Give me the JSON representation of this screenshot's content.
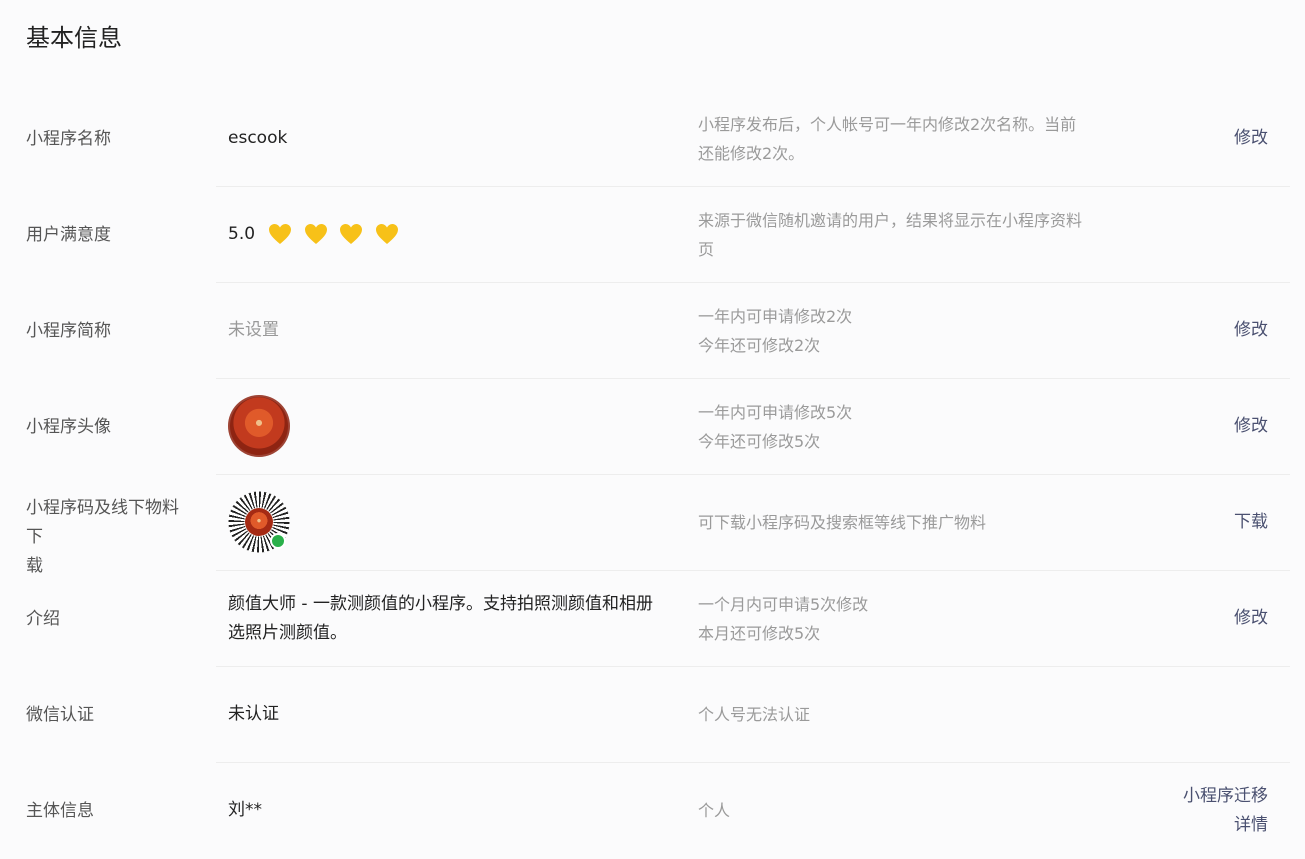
{
  "section_title": "基本信息",
  "colors": {
    "heart": "#f7c118",
    "action": "#4a5070",
    "muted": "#9a9a9a"
  },
  "rows": [
    {
      "label": "小程序名称",
      "value": "escook",
      "desc": [
        "小程序发布后，个人帐号可一年内修改2次名称。当前",
        "还能修改2次。"
      ],
      "action": [
        "修改"
      ]
    },
    {
      "label": "用户满意度",
      "value": "5.0",
      "hearts": 4,
      "desc": [
        "来源于微信随机邀请的用户，结果将显示在小程序资料",
        "页"
      ],
      "action": []
    },
    {
      "label": "小程序简称",
      "value": "未设置",
      "desc": [
        "一年内可申请修改2次",
        "今年还可修改2次"
      ],
      "action": [
        "修改"
      ]
    },
    {
      "label": "小程序头像",
      "icon": "app-avatar-icon",
      "desc": [
        "一年内可申请修改5次",
        "今年还可修改5次"
      ],
      "action": [
        "修改"
      ]
    },
    {
      "label": [
        "小程序码及线下物料下",
        "载"
      ],
      "icon": "mini-program-code-icon",
      "desc": [
        "可下载小程序码及搜索框等线下推广物料"
      ],
      "action": [
        "下载"
      ]
    },
    {
      "label": "介绍",
      "value": [
        "颜值大师 - 一款测颜值的小程序。支持拍照测颜值和相册",
        "选照片测颜值。"
      ],
      "desc": [
        "一个月内可申请5次修改",
        "本月还可修改5次"
      ],
      "action": [
        "修改"
      ]
    },
    {
      "label": "微信认证",
      "value": "未认证",
      "desc": [
        "个人号无法认证"
      ],
      "action": []
    },
    {
      "label": "主体信息",
      "value": "刘**",
      "desc": [
        "个人"
      ],
      "action": [
        "小程序迁移",
        "详情"
      ]
    }
  ]
}
